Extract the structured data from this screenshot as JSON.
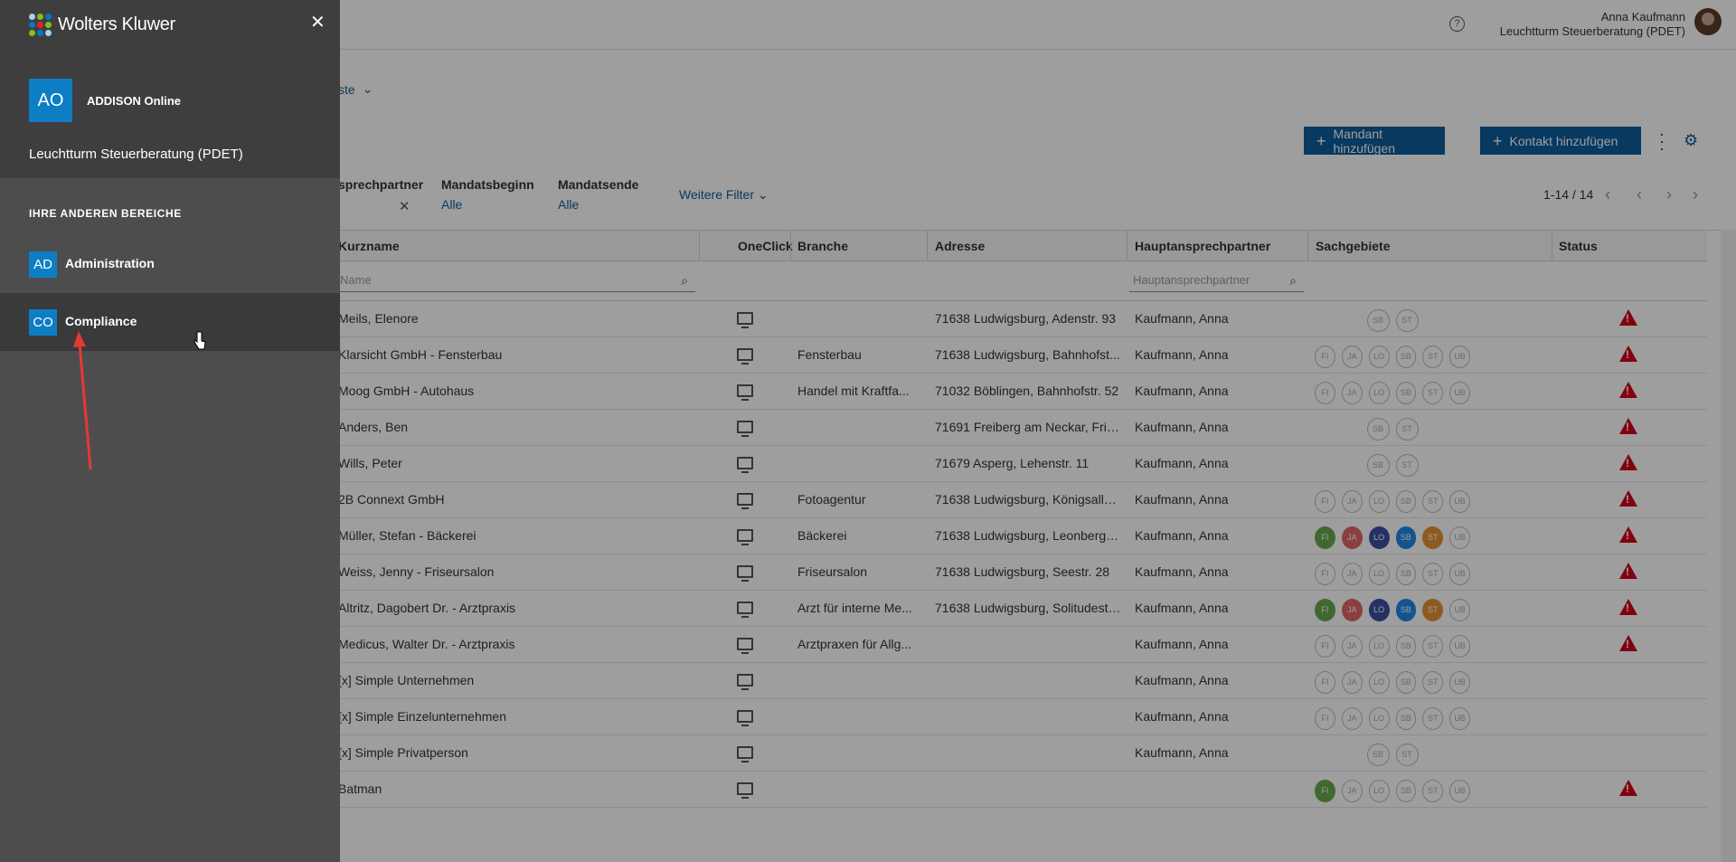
{
  "topbar": {
    "user_name": "Anna Kaufmann",
    "user_org": "Leuchtturm Steuerberatung (PDET)",
    "help_icon": "?"
  },
  "toolbar": {
    "list_dropdown": "ste",
    "add_client": "Mandant hinzufügen",
    "add_contact": "Kontakt hinzufügen"
  },
  "filters": {
    "contact_label": "sprechpartner",
    "start_label": "Mandatsbeginn",
    "start_value": "Alle",
    "end_label": "Mandatsende",
    "end_value": "Alle",
    "more": "Weitere Filter",
    "pagination": "1-14 / 14"
  },
  "grid": {
    "headers": {
      "name": "Kurzname",
      "oneclick": "OneClick",
      "branch": "Branche",
      "address": "Adresse",
      "contact": "Hauptansprechpartner",
      "areas": "Sachgebiete",
      "status": "Status"
    },
    "search": {
      "name_placeholder": "Name",
      "contact_placeholder": "Hauptansprechpartner"
    },
    "rows": [
      {
        "name": "Meils, Elenore",
        "branch": "",
        "address": "71638 Ludwigsburg, Adenstr. 93",
        "contact": "Kaufmann, Anna",
        "badges": "two",
        "status": true
      },
      {
        "name": "Klarsicht GmbH - Fensterbau",
        "branch": "Fensterbau",
        "address": "71638 Ludwigsburg, Bahnhofst...",
        "contact": "Kaufmann, Anna",
        "badges": "all",
        "status": true
      },
      {
        "name": "Moog GmbH - Autohaus",
        "branch": "Handel mit Kraftfa...",
        "address": "71032 Böblingen, Bahnhofstr. 52",
        "contact": "Kaufmann, Anna",
        "badges": "all",
        "status": true
      },
      {
        "name": "Anders, Ben",
        "branch": "",
        "address": "71691 Freiberg am Neckar, Frie...",
        "contact": "Kaufmann, Anna",
        "badges": "two",
        "status": true
      },
      {
        "name": "Wills, Peter",
        "branch": "",
        "address": "71679 Asperg, Lehenstr. 11",
        "contact": "Kaufmann, Anna",
        "badges": "two",
        "status": true
      },
      {
        "name": "2B Connext GmbH",
        "branch": "Fotoagentur",
        "address": "71638 Ludwigsburg, Königsalle...",
        "contact": "Kaufmann, Anna",
        "badges": "all",
        "status": true
      },
      {
        "name": "Müller, Stefan - Bäckerei",
        "branch": "Bäckerei",
        "address": "71638 Ludwigsburg, Leonberge...",
        "contact": "Kaufmann, Anna",
        "badges": "colored5",
        "status": true
      },
      {
        "name": "Weiss, Jenny - Friseursalon",
        "branch": "Friseursalon",
        "address": "71638 Ludwigsburg, Seestr. 28",
        "contact": "Kaufmann, Anna",
        "badges": "all",
        "status": true
      },
      {
        "name": "Altritz, Dagobert Dr. - Arztpraxis",
        "branch": "Arzt für interne Me...",
        "address": "71638 Ludwigsburg, Solitudestr...",
        "contact": "Kaufmann, Anna",
        "badges": "colored5",
        "status": true
      },
      {
        "name": "Medicus, Walter Dr. - Arztpraxis",
        "branch": "Arztpraxen für Allg...",
        "address": "",
        "contact": "Kaufmann, Anna",
        "badges": "all",
        "status": true
      },
      {
        "name": "[x] Simple Unternehmen",
        "branch": "",
        "address": "",
        "contact": "Kaufmann, Anna",
        "badges": "all",
        "status": false
      },
      {
        "name": "[x] Simple Einzelunternehmen",
        "branch": "",
        "address": "",
        "contact": "Kaufmann, Anna",
        "badges": "all",
        "status": false
      },
      {
        "name": "[x] Simple Privatperson",
        "branch": "",
        "address": "",
        "contact": "Kaufmann, Anna",
        "badges": "two",
        "status": false
      },
      {
        "name": "Batman",
        "branch": "",
        "address": "",
        "contact": "",
        "badges": "fi",
        "status": true
      }
    ],
    "badge_labels": [
      "FI",
      "JA",
      "LO",
      "SB",
      "ST",
      "UB"
    ],
    "badge_colors": {
      "FI": "#6aa84f",
      "JA": "#e06666",
      "LO": "#3c4fa0",
      "SB": "#1e88e5",
      "ST": "#e69138"
    }
  },
  "panel": {
    "brand": "Wolters Kluwer",
    "close": "✕",
    "product_tile": "AO",
    "product_name": "ADDISON Online",
    "firm": "Leuchtturm Steuerberatung (PDET)",
    "section_title": "IHRE ANDEREN BEREICHE",
    "items": [
      {
        "tile": "AD",
        "label": "Administration"
      },
      {
        "tile": "CO",
        "label": "Compliance"
      }
    ]
  }
}
